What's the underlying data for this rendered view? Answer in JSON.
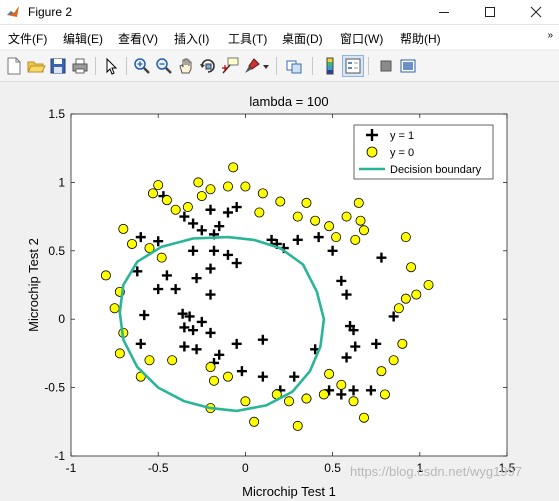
{
  "window": {
    "title": "Figure 2",
    "icon": "matlab-icon",
    "controls": [
      "minimize-icon",
      "maximize-icon",
      "close-icon"
    ]
  },
  "menu": {
    "items": [
      "文件(F)",
      "编辑(E)",
      "查看(V)",
      "插入(I)",
      "工具(T)",
      "桌面(D)",
      "窗口(W)",
      "帮助(H)"
    ],
    "overflow": "»"
  },
  "toolbar": {
    "icons": [
      "new-figure-icon",
      "open-file-icon",
      "save-icon",
      "print-icon",
      "edit-plot-icon",
      "zoom-in-icon",
      "zoom-out-icon",
      "pan-icon",
      "rotate-3d-icon",
      "data-cursor-icon",
      "brush-icon",
      "link-plot-icon",
      "colorbar-icon",
      "legend-icon",
      "hide-plot-tools-icon",
      "show-plot-tools-icon"
    ]
  },
  "colors": {
    "accent": "#2bb598",
    "y0_fill": "#ffff00",
    "axes_bg": "#ffffff",
    "figure_bg": "#f0f0f0"
  },
  "watermark": "https://blog.csdn.net/wyg1997",
  "chart_data": {
    "type": "scatter",
    "title": "lambda = 100",
    "xlabel": "Microchip Test 1",
    "ylabel": "Microchip Test 2",
    "xlim": [
      -1,
      1.5
    ],
    "ylim": [
      -1,
      1.5
    ],
    "xticks": [
      -1,
      -0.5,
      0,
      0.5,
      1,
      1.5
    ],
    "yticks": [
      -1,
      -0.5,
      0,
      0.5,
      1,
      1.5
    ],
    "grid": false,
    "legend_position": "top-right",
    "legend": [
      "y = 1",
      "y = 0",
      "Decision boundary"
    ],
    "series": [
      {
        "name": "y = 1",
        "marker": "plus",
        "points": [
          [
            -0.47,
            0.9
          ],
          [
            -0.35,
            0.75
          ],
          [
            -0.3,
            0.7
          ],
          [
            -0.25,
            0.65
          ],
          [
            -0.2,
            0.8
          ],
          [
            -0.15,
            0.68
          ],
          [
            -0.1,
            0.78
          ],
          [
            -0.05,
            0.82
          ],
          [
            -0.18,
            0.62
          ],
          [
            -0.6,
            0.6
          ],
          [
            -0.5,
            0.57
          ],
          [
            -0.3,
            0.5
          ],
          [
            -0.18,
            0.5
          ],
          [
            -0.1,
            0.47
          ],
          [
            -0.05,
            0.41
          ],
          [
            0.15,
            0.58
          ],
          [
            0.18,
            0.55
          ],
          [
            0.22,
            0.52
          ],
          [
            0.3,
            0.58
          ],
          [
            0.42,
            0.6
          ],
          [
            -0.62,
            0.35
          ],
          [
            -0.45,
            0.32
          ],
          [
            -0.28,
            0.3
          ],
          [
            -0.2,
            0.37
          ],
          [
            -0.5,
            0.22
          ],
          [
            -0.4,
            0.22
          ],
          [
            -0.2,
            0.18
          ],
          [
            -0.58,
            0.03
          ],
          [
            -0.36,
            0.04
          ],
          [
            -0.32,
            0.02
          ],
          [
            -0.25,
            -0.02
          ],
          [
            -0.35,
            -0.06
          ],
          [
            -0.3,
            -0.08
          ],
          [
            -0.2,
            -0.1
          ],
          [
            -0.6,
            -0.18
          ],
          [
            -0.35,
            -0.2
          ],
          [
            -0.28,
            -0.22
          ],
          [
            -0.15,
            -0.26
          ],
          [
            -0.05,
            -0.18
          ],
          [
            0.1,
            -0.15
          ],
          [
            -0.18,
            -0.32
          ],
          [
            -0.02,
            -0.38
          ],
          [
            0.1,
            -0.42
          ],
          [
            0.2,
            -0.52
          ],
          [
            0.28,
            -0.42
          ],
          [
            0.35,
            -0.58
          ],
          [
            0.4,
            -0.22
          ],
          [
            0.5,
            0.5
          ],
          [
            0.55,
            0.28
          ],
          [
            0.58,
            0.18
          ],
          [
            0.6,
            -0.05
          ],
          [
            0.62,
            -0.08
          ],
          [
            0.63,
            -0.2
          ],
          [
            0.58,
            -0.28
          ],
          [
            0.48,
            -0.52
          ],
          [
            0.55,
            -0.55
          ],
          [
            0.62,
            -0.52
          ],
          [
            0.72,
            -0.52
          ],
          [
            0.75,
            -0.18
          ],
          [
            0.78,
            0.45
          ],
          [
            0.85,
            0.02
          ]
        ]
      },
      {
        "name": "y = 0",
        "marker": "circle",
        "points": [
          [
            -0.07,
            1.11
          ],
          [
            -0.27,
            1.0
          ],
          [
            -0.2,
            0.95
          ],
          [
            -0.1,
            0.97
          ],
          [
            0.0,
            0.97
          ],
          [
            0.1,
            0.92
          ],
          [
            0.2,
            0.86
          ],
          [
            0.35,
            0.85
          ],
          [
            -0.5,
            0.98
          ],
          [
            -0.53,
            0.92
          ],
          [
            -0.45,
            0.87
          ],
          [
            -0.4,
            0.8
          ],
          [
            -0.33,
            0.82
          ],
          [
            -0.25,
            0.9
          ],
          [
            0.08,
            0.78
          ],
          [
            0.3,
            0.75
          ],
          [
            0.4,
            0.72
          ],
          [
            0.48,
            0.68
          ],
          [
            0.52,
            0.6
          ],
          [
            0.63,
            0.58
          ],
          [
            0.68,
            0.65
          ],
          [
            0.66,
            0.72
          ],
          [
            0.65,
            0.85
          ],
          [
            0.58,
            0.75
          ],
          [
            -0.7,
            0.66
          ],
          [
            -0.65,
            0.55
          ],
          [
            -0.55,
            0.52
          ],
          [
            -0.48,
            0.45
          ],
          [
            -0.8,
            0.32
          ],
          [
            -0.72,
            0.2
          ],
          [
            -0.75,
            0.08
          ],
          [
            -0.7,
            -0.1
          ],
          [
            -0.72,
            -0.25
          ],
          [
            -0.6,
            -0.42
          ],
          [
            -0.55,
            -0.3
          ],
          [
            -0.42,
            -0.3
          ],
          [
            -0.2,
            -0.35
          ],
          [
            -0.18,
            -0.45
          ],
          [
            -0.1,
            -0.42
          ],
          [
            -0.2,
            -0.65
          ],
          [
            0.0,
            -0.6
          ],
          [
            0.05,
            -0.75
          ],
          [
            0.18,
            -0.55
          ],
          [
            0.25,
            -0.6
          ],
          [
            0.3,
            -0.78
          ],
          [
            0.35,
            -0.58
          ],
          [
            0.45,
            -0.55
          ],
          [
            0.48,
            -0.4
          ],
          [
            0.55,
            -0.48
          ],
          [
            0.62,
            -0.6
          ],
          [
            0.68,
            -0.72
          ],
          [
            0.8,
            -0.55
          ],
          [
            0.78,
            -0.38
          ],
          [
            0.85,
            -0.3
          ],
          [
            0.9,
            -0.18
          ],
          [
            0.88,
            0.08
          ],
          [
            0.92,
            0.15
          ],
          [
            0.98,
            0.18
          ],
          [
            1.05,
            0.25
          ],
          [
            0.95,
            0.38
          ],
          [
            0.92,
            0.6
          ]
        ]
      },
      {
        "name": "Decision boundary",
        "type": "line",
        "points": [
          [
            -0.1,
            0.6
          ],
          [
            0.05,
            0.58
          ],
          [
            0.2,
            0.52
          ],
          [
            0.33,
            0.4
          ],
          [
            0.41,
            0.2
          ],
          [
            0.45,
            0.0
          ],
          [
            0.43,
            -0.2
          ],
          [
            0.37,
            -0.38
          ],
          [
            0.27,
            -0.53
          ],
          [
            0.12,
            -0.63
          ],
          [
            -0.05,
            -0.67
          ],
          [
            -0.2,
            -0.65
          ],
          [
            -0.35,
            -0.6
          ],
          [
            -0.5,
            -0.5
          ],
          [
            -0.62,
            -0.35
          ],
          [
            -0.7,
            -0.15
          ],
          [
            -0.72,
            0.05
          ],
          [
            -0.7,
            0.25
          ],
          [
            -0.62,
            0.42
          ],
          [
            -0.48,
            0.53
          ],
          [
            -0.3,
            0.59
          ],
          [
            -0.1,
            0.6
          ]
        ]
      }
    ]
  }
}
